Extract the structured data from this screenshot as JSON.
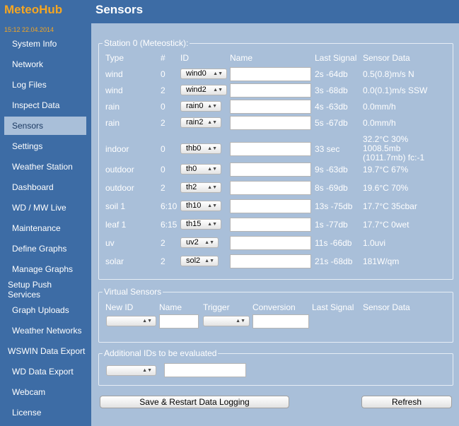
{
  "app": {
    "title": "MeteoHub",
    "datetime": "15:12   22.04.2014"
  },
  "page": {
    "title": "Sensors"
  },
  "sidebar": {
    "items": [
      {
        "label": "System Info",
        "active": false
      },
      {
        "label": "Network",
        "active": false
      },
      {
        "label": "Log Files",
        "active": false
      },
      {
        "label": "Inspect Data",
        "active": false
      },
      {
        "label": "Sensors",
        "active": true
      },
      {
        "label": "Settings",
        "active": false
      },
      {
        "label": "Weather Station",
        "active": false
      },
      {
        "label": "Dashboard",
        "active": false
      },
      {
        "label": "WD / MW Live",
        "active": false
      },
      {
        "label": "Maintenance",
        "active": false
      },
      {
        "label": "Define Graphs",
        "active": false
      },
      {
        "label": "Manage Graphs",
        "active": false
      },
      {
        "label": "Setup Push Services",
        "active": false
      },
      {
        "label": "Graph Uploads",
        "active": false
      },
      {
        "label": "Weather Networks",
        "active": false
      },
      {
        "label": "WSWIN Data Export",
        "active": false
      },
      {
        "label": "WD Data Export",
        "active": false
      },
      {
        "label": "Webcam",
        "active": false
      },
      {
        "label": "License",
        "active": false
      }
    ]
  },
  "station": {
    "legend": "Station 0 (Meteostick):",
    "headers": {
      "type": "Type",
      "num": "#",
      "id": "ID",
      "name": "Name",
      "last_signal": "Last Signal",
      "sensor_data": "Sensor Data"
    },
    "rows": [
      {
        "type": "wind",
        "num": "0",
        "id": "wind0",
        "name": "",
        "last_signal": "2s -64db",
        "sensor_data": "0.5(0.8)m/s N"
      },
      {
        "type": "wind",
        "num": "2",
        "id": "wind2",
        "name": "",
        "last_signal": "3s -68db",
        "sensor_data": "0.0(0.1)m/s SSW"
      },
      {
        "type": "rain",
        "num": "0",
        "id": "rain0",
        "name": "",
        "last_signal": "4s -63db",
        "sensor_data": "0.0mm/h"
      },
      {
        "type": "rain",
        "num": "2",
        "id": "rain2",
        "name": "",
        "last_signal": "5s -67db",
        "sensor_data": "0.0mm/h"
      },
      {
        "type": "indoor",
        "num": "0",
        "id": "thb0",
        "name": "",
        "last_signal": "33 sec",
        "sensor_data": "32.2°C 30%\n1008.5mb\n(1011.7mb) fc:-1"
      },
      {
        "type": "outdoor",
        "num": "0",
        "id": "th0",
        "name": "",
        "last_signal": "9s -63db",
        "sensor_data": "19.7°C 67%"
      },
      {
        "type": "outdoor",
        "num": "2",
        "id": "th2",
        "name": "",
        "last_signal": "8s -69db",
        "sensor_data": "19.6°C 70%"
      },
      {
        "type": "soil 1",
        "num": "6:10",
        "id": "th10",
        "name": "",
        "last_signal": "13s -75db",
        "sensor_data": "17.7°C 35cbar"
      },
      {
        "type": "leaf 1",
        "num": "6:15",
        "id": "th15",
        "name": "",
        "last_signal": "1s -77db",
        "sensor_data": "17.7°C 0wet"
      },
      {
        "type": "uv",
        "num": "2",
        "id": "uv2",
        "name": "",
        "last_signal": "11s -66db",
        "sensor_data": "1.0uvi"
      },
      {
        "type": "solar",
        "num": "2",
        "id": "sol2",
        "name": "",
        "last_signal": "21s -68db",
        "sensor_data": "181W/qm"
      }
    ]
  },
  "virtual": {
    "legend": "Virtual Sensors",
    "headers": {
      "new_id": "New ID",
      "name": "Name",
      "trigger": "Trigger",
      "conversion": "Conversion",
      "last_signal": "Last Signal",
      "sensor_data": "Sensor Data"
    },
    "new_id_value": "",
    "name_value": "",
    "trigger_value": "",
    "conversion_value": ""
  },
  "additional": {
    "legend": "Additional IDs to be evaluated",
    "select_value": "",
    "input_value": ""
  },
  "buttons": {
    "save": "Save & Restart Data Logging",
    "refresh": "Refresh"
  },
  "colors": {
    "sidebar_bg": "#3d6ca5",
    "content_bg": "#a9bfd9",
    "accent": "#f4a623"
  },
  "icons": {
    "select_arrow": "updown-arrows-icon"
  }
}
